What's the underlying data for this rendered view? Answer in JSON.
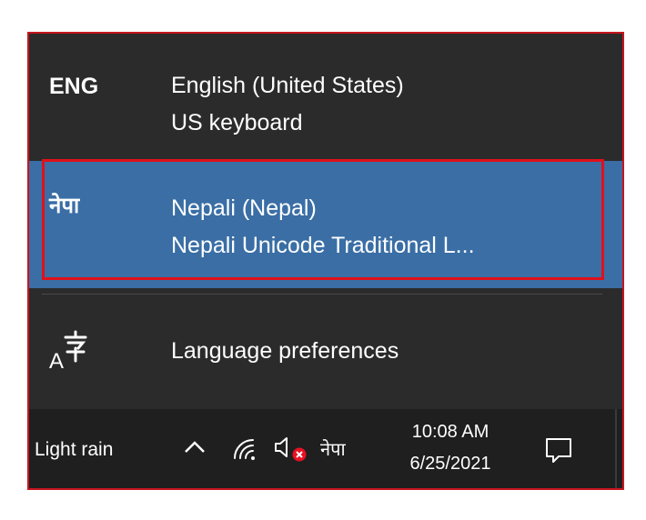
{
  "language_flyout": {
    "languages": [
      {
        "code": "ENG",
        "name": "English (United States)",
        "keyboard": "US keyboard",
        "selected": false
      },
      {
        "code": "नेपा",
        "name": "Nepali (Nepal)",
        "keyboard": "Nepali Unicode Traditional L...",
        "selected": true
      }
    ],
    "preferences_label": "Language preferences",
    "preferences_icon": "language-preferences-icon"
  },
  "taskbar": {
    "weather": "Light rain",
    "input_indicator": "नेपा",
    "time": "10:08 AM",
    "date": "6/25/2021",
    "icons": [
      "chevron-up-icon",
      "wifi-icon",
      "volume-muted-icon",
      "action-center-icon"
    ]
  },
  "colors": {
    "flyout_bg": "#2b2b2b",
    "selected_bg": "#3a6ea5",
    "taskbar_bg": "#1f1f1f",
    "highlight_border": "#e0101a"
  }
}
